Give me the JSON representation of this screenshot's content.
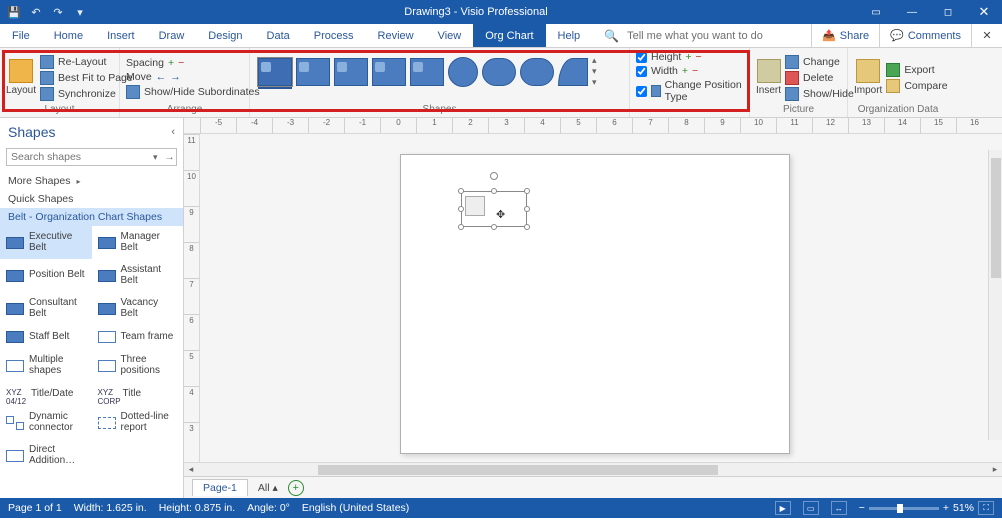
{
  "titlebar": {
    "title": "Drawing3 - Visio Professional"
  },
  "menu": {
    "tabs": [
      "File",
      "Home",
      "Insert",
      "Draw",
      "Design",
      "Data",
      "Process",
      "Review",
      "View",
      "Org Chart",
      "Help"
    ],
    "active": 9,
    "tell_me": "Tell me what you want to do",
    "share": "Share",
    "comments": "Comments"
  },
  "ribbon": {
    "layout": {
      "label": "Layout",
      "big": "Layout",
      "relayout": "Re-Layout",
      "bestfit": "Best Fit to Page",
      "sync": "Synchronize"
    },
    "arrange": {
      "label": "Arrange",
      "spacing": "Spacing",
      "move": "Move",
      "showhide": "Show/Hide Subordinates"
    },
    "shapes_label": "Shapes",
    "size": {
      "height": "Height",
      "width": "Width",
      "cpt": "Change Position Type"
    },
    "picture": {
      "label": "Picture",
      "insert": "Insert",
      "change": "Change",
      "delete": "Delete",
      "showhide": "Show/Hide"
    },
    "orgdata": {
      "label": "Organization Data",
      "import": "Import",
      "export": "Export",
      "compare": "Compare"
    }
  },
  "shapes_panel": {
    "title": "Shapes",
    "search_ph": "Search shapes",
    "more": "More Shapes",
    "quick": "Quick Shapes",
    "category": "Belt - Organization Chart Shapes",
    "items": [
      "Executive Belt",
      "Manager Belt",
      "Position Belt",
      "Assistant Belt",
      "Consultant Belt",
      "Vacancy Belt",
      "Staff Belt",
      "Team frame",
      "Multiple shapes",
      "Three positions",
      "Title/Date",
      "Title",
      "Dynamic connector",
      "Dotted-line report",
      "Direct Addition…",
      ""
    ]
  },
  "ruler_h": [
    "-5",
    "-4",
    "-3",
    "-2",
    "-1",
    "0",
    "1",
    "2",
    "3",
    "4",
    "5",
    "6",
    "7",
    "8",
    "9",
    "10",
    "11",
    "12",
    "13",
    "14",
    "15",
    "16"
  ],
  "ruler_v": [
    "11",
    "10",
    "9",
    "8",
    "7",
    "6",
    "5",
    "4",
    "3"
  ],
  "pagetabs": {
    "page1": "Page-1",
    "all": "All"
  },
  "status": {
    "pages": "Page 1 of 1",
    "width": "Width: 1.625 in.",
    "height": "Height: 0.875 in.",
    "angle": "Angle: 0°",
    "lang": "English (United States)",
    "zoom": "51%"
  }
}
